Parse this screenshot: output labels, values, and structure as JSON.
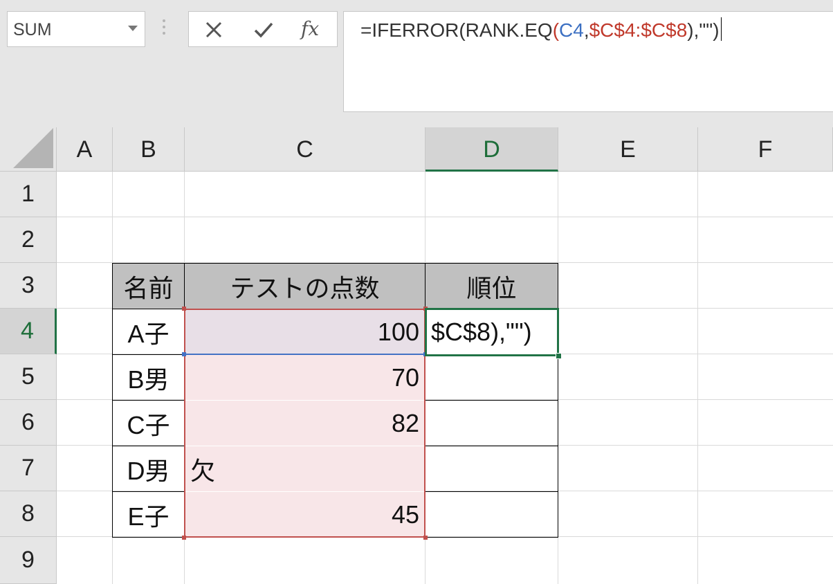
{
  "name_box": {
    "value": "SUM"
  },
  "formula_bar": {
    "buttons": {
      "cancel": "cancel-icon",
      "enter": "check-icon",
      "fx_label": "fx"
    },
    "formula_parts": {
      "prefix": "=IFERROR(RANK.EQ",
      "paren_open": "(",
      "ref1": "C4",
      "comma": ",",
      "ref2": "$C$4:$C$8",
      "suffix": "),\"\")"
    }
  },
  "columns": [
    "A",
    "B",
    "C",
    "D",
    "E",
    "F"
  ],
  "active_column": "D",
  "rows": [
    "1",
    "2",
    "3",
    "4",
    "5",
    "6",
    "7",
    "8",
    "9"
  ],
  "active_row": "4",
  "table": {
    "headers": {
      "name": "名前",
      "score": "テストの点数",
      "rank": "順位"
    },
    "rows": [
      {
        "name": "A子",
        "score": "100",
        "rank": "$C$8),\"\")"
      },
      {
        "name": "B男",
        "score": "70",
        "rank": ""
      },
      {
        "name": "C子",
        "score": "82",
        "rank": ""
      },
      {
        "name": "D男",
        "score": "欠",
        "rank": ""
      },
      {
        "name": "E子",
        "score": "45",
        "rank": ""
      }
    ]
  },
  "colors": {
    "accent_green": "#217346",
    "range_red": "#c0504d",
    "range_blue": "#4472c4",
    "header_fill": "#c0c0c0",
    "range_fill": "#f8e6e8"
  }
}
